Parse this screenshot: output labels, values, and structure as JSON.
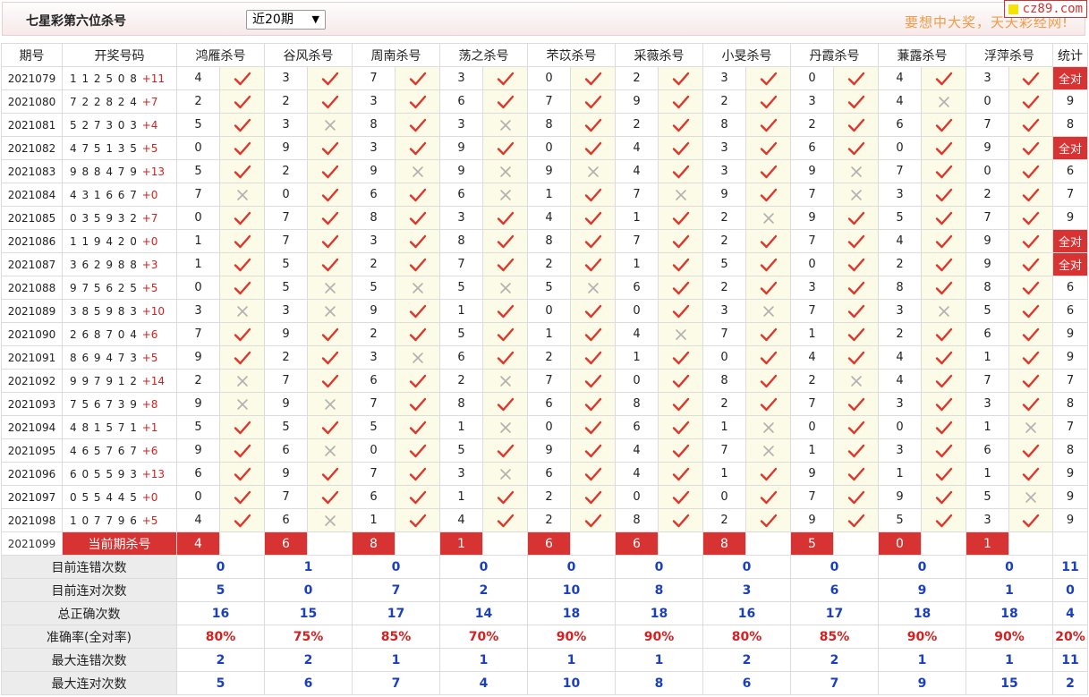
{
  "header": {
    "title": "七星彩第六位杀号",
    "period_select": "近20期",
    "slogan": "要想中大奖，天天彩经网!",
    "site_badge": "cz89.com"
  },
  "columns": {
    "issue": "期号",
    "numbers": "开奖号码",
    "experts": [
      "鸿雁杀号",
      "谷风杀号",
      "周南杀号",
      "荡之杀号",
      "芣苡杀号",
      "采薇杀号",
      "小旻杀号",
      "丹霞杀号",
      "蒹露杀号",
      "浮萍杀号"
    ],
    "stat": "统计"
  },
  "colors": {
    "accent_red": "#d83333",
    "check_red": "#e0352b",
    "cross_gray": "#b0b0b0",
    "value_blue": "#1a3fbf",
    "slogan_orange": "#f39a45"
  },
  "draws": [
    {
      "issue": "2021079",
      "nums": "1 1 2 5 0 8",
      "sum": "+11",
      "kills": [
        "4",
        "3",
        "7",
        "3",
        "0",
        "2",
        "3",
        "0",
        "4",
        "3"
      ],
      "ok": [
        1,
        1,
        1,
        1,
        1,
        1,
        1,
        1,
        1,
        1
      ],
      "stat": "全对",
      "full": true
    },
    {
      "issue": "2021080",
      "nums": "7 2 2 8 2 4",
      "sum": "+7",
      "kills": [
        "2",
        "2",
        "3",
        "6",
        "7",
        "9",
        "2",
        "3",
        "4",
        "0"
      ],
      "ok": [
        1,
        1,
        1,
        1,
        1,
        1,
        1,
        1,
        0,
        1
      ],
      "stat": "9",
      "full": false
    },
    {
      "issue": "2021081",
      "nums": "5 2 7 3 0 3",
      "sum": "+4",
      "kills": [
        "5",
        "3",
        "8",
        "3",
        "8",
        "2",
        "8",
        "2",
        "6",
        "7"
      ],
      "ok": [
        1,
        0,
        1,
        0,
        1,
        1,
        1,
        1,
        1,
        1
      ],
      "stat": "8",
      "full": false
    },
    {
      "issue": "2021082",
      "nums": "4 7 5 1 3 5",
      "sum": "+5",
      "kills": [
        "0",
        "9",
        "3",
        "9",
        "0",
        "4",
        "3",
        "6",
        "0",
        "9"
      ],
      "ok": [
        1,
        1,
        1,
        1,
        1,
        1,
        1,
        1,
        1,
        1
      ],
      "stat": "全对",
      "full": true
    },
    {
      "issue": "2021083",
      "nums": "9 8 8 4 7 9",
      "sum": "+13",
      "kills": [
        "5",
        "2",
        "9",
        "9",
        "9",
        "4",
        "3",
        "9",
        "7",
        "0"
      ],
      "ok": [
        1,
        1,
        0,
        0,
        0,
        1,
        1,
        0,
        1,
        1
      ],
      "stat": "6",
      "full": false
    },
    {
      "issue": "2021084",
      "nums": "4 3 1 6 6 7",
      "sum": "+0",
      "kills": [
        "7",
        "0",
        "6",
        "6",
        "1",
        "7",
        "9",
        "7",
        "3",
        "2"
      ],
      "ok": [
        0,
        1,
        1,
        0,
        1,
        0,
        1,
        0,
        1,
        1
      ],
      "stat": "7",
      "full": false
    },
    {
      "issue": "2021085",
      "nums": "0 3 5 9 3 2",
      "sum": "+7",
      "kills": [
        "0",
        "7",
        "8",
        "3",
        "4",
        "1",
        "2",
        "9",
        "5",
        "7"
      ],
      "ok": [
        1,
        1,
        1,
        1,
        1,
        1,
        0,
        1,
        1,
        1
      ],
      "stat": "9",
      "full": false
    },
    {
      "issue": "2021086",
      "nums": "1 1 9 4 2 0",
      "sum": "+0",
      "kills": [
        "1",
        "7",
        "3",
        "8",
        "8",
        "7",
        "2",
        "7",
        "4",
        "9"
      ],
      "ok": [
        1,
        1,
        1,
        1,
        1,
        1,
        1,
        1,
        1,
        1
      ],
      "stat": "全对",
      "full": true
    },
    {
      "issue": "2021087",
      "nums": "3 6 2 9 8 8",
      "sum": "+3",
      "kills": [
        "1",
        "5",
        "2",
        "7",
        "2",
        "1",
        "5",
        "0",
        "2",
        "9"
      ],
      "ok": [
        1,
        1,
        1,
        1,
        1,
        1,
        1,
        1,
        1,
        1
      ],
      "stat": "全对",
      "full": true
    },
    {
      "issue": "2021088",
      "nums": "9 7 5 6 2 5",
      "sum": "+5",
      "kills": [
        "0",
        "5",
        "5",
        "5",
        "5",
        "6",
        "2",
        "3",
        "8",
        "8"
      ],
      "ok": [
        1,
        0,
        0,
        0,
        0,
        1,
        1,
        1,
        1,
        1
      ],
      "stat": "6",
      "full": false
    },
    {
      "issue": "2021089",
      "nums": "3 8 5 9 8 3",
      "sum": "+10",
      "kills": [
        "3",
        "3",
        "9",
        "1",
        "0",
        "0",
        "3",
        "7",
        "3",
        "5"
      ],
      "ok": [
        0,
        0,
        1,
        1,
        1,
        1,
        0,
        1,
        0,
        1
      ],
      "stat": "6",
      "full": false
    },
    {
      "issue": "2021090",
      "nums": "2 6 8 7 0 4",
      "sum": "+6",
      "kills": [
        "7",
        "9",
        "2",
        "5",
        "1",
        "4",
        "7",
        "1",
        "2",
        "6"
      ],
      "ok": [
        1,
        1,
        1,
        1,
        1,
        0,
        1,
        1,
        1,
        1
      ],
      "stat": "9",
      "full": false
    },
    {
      "issue": "2021091",
      "nums": "8 6 9 4 7 3",
      "sum": "+5",
      "kills": [
        "9",
        "2",
        "3",
        "6",
        "2",
        "1",
        "0",
        "4",
        "4",
        "1"
      ],
      "ok": [
        1,
        1,
        0,
        1,
        1,
        1,
        1,
        1,
        1,
        1
      ],
      "stat": "9",
      "full": false
    },
    {
      "issue": "2021092",
      "nums": "9 9 7 9 1 2",
      "sum": "+14",
      "kills": [
        "2",
        "7",
        "6",
        "2",
        "7",
        "0",
        "8",
        "2",
        "4",
        "7"
      ],
      "ok": [
        0,
        1,
        1,
        0,
        1,
        1,
        1,
        0,
        1,
        1
      ],
      "stat": "7",
      "full": false
    },
    {
      "issue": "2021093",
      "nums": "7 5 6 7 3 9",
      "sum": "+8",
      "kills": [
        "9",
        "9",
        "7",
        "8",
        "6",
        "8",
        "2",
        "7",
        "3",
        "3"
      ],
      "ok": [
        0,
        0,
        1,
        1,
        1,
        1,
        1,
        1,
        1,
        1
      ],
      "stat": "8",
      "full": false
    },
    {
      "issue": "2021094",
      "nums": "4 8 1 5 7 1",
      "sum": "+1",
      "kills": [
        "5",
        "5",
        "5",
        "1",
        "0",
        "6",
        "1",
        "0",
        "0",
        "1"
      ],
      "ok": [
        1,
        1,
        1,
        0,
        1,
        1,
        0,
        1,
        1,
        0
      ],
      "stat": "7",
      "full": false
    },
    {
      "issue": "2021095",
      "nums": "4 6 5 7 6 7",
      "sum": "+6",
      "kills": [
        "9",
        "6",
        "0",
        "5",
        "9",
        "4",
        "7",
        "1",
        "3",
        "6"
      ],
      "ok": [
        1,
        0,
        1,
        1,
        1,
        1,
        0,
        1,
        1,
        1
      ],
      "stat": "8",
      "full": false
    },
    {
      "issue": "2021096",
      "nums": "6 0 5 5 9 3",
      "sum": "+13",
      "kills": [
        "6",
        "9",
        "7",
        "3",
        "6",
        "4",
        "1",
        "9",
        "1",
        "1"
      ],
      "ok": [
        1,
        1,
        1,
        0,
        1,
        1,
        1,
        1,
        1,
        1
      ],
      "stat": "9",
      "full": false
    },
    {
      "issue": "2021097",
      "nums": "0 5 5 4 4 5",
      "sum": "+0",
      "kills": [
        "0",
        "7",
        "6",
        "1",
        "2",
        "0",
        "0",
        "7",
        "9",
        "5"
      ],
      "ok": [
        1,
        1,
        1,
        1,
        1,
        1,
        1,
        1,
        1,
        0
      ],
      "stat": "9",
      "full": false
    },
    {
      "issue": "2021098",
      "nums": "1 0 7 7 9 6",
      "sum": "+5",
      "kills": [
        "4",
        "6",
        "1",
        "4",
        "2",
        "8",
        "2",
        "9",
        "5",
        "3"
      ],
      "ok": [
        1,
        0,
        1,
        1,
        1,
        1,
        1,
        1,
        1,
        1
      ],
      "stat": "9",
      "full": false
    }
  ],
  "current": {
    "issue": "2021099",
    "label": "当前期杀号",
    "kills": [
      "4",
      "6",
      "8",
      "1",
      "6",
      "6",
      "8",
      "5",
      "0",
      "1"
    ]
  },
  "summary": [
    {
      "label": "目前连错次数",
      "values": [
        "0",
        "1",
        "0",
        "0",
        "0",
        "0",
        "0",
        "0",
        "0",
        "0"
      ],
      "stat": "11",
      "red": false
    },
    {
      "label": "目前连对次数",
      "values": [
        "5",
        "0",
        "7",
        "2",
        "10",
        "8",
        "3",
        "6",
        "9",
        "1"
      ],
      "stat": "0",
      "red": false
    },
    {
      "label": "总正确次数",
      "values": [
        "16",
        "15",
        "17",
        "14",
        "18",
        "18",
        "16",
        "17",
        "18",
        "18"
      ],
      "stat": "4",
      "red": false
    },
    {
      "label": "准确率(全对率)",
      "values": [
        "80%",
        "75%",
        "85%",
        "70%",
        "90%",
        "90%",
        "80%",
        "85%",
        "90%",
        "90%"
      ],
      "stat": "20%",
      "red": true
    },
    {
      "label": "最大连错次数",
      "values": [
        "2",
        "2",
        "1",
        "1",
        "1",
        "1",
        "2",
        "2",
        "1",
        "1"
      ],
      "stat": "11",
      "red": false
    },
    {
      "label": "最大连对次数",
      "values": [
        "5",
        "6",
        "7",
        "4",
        "10",
        "8",
        "6",
        "7",
        "9",
        "15"
      ],
      "stat": "2",
      "red": false
    }
  ]
}
